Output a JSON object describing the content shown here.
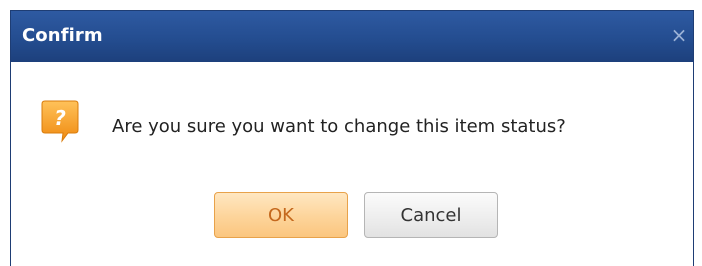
{
  "dialog": {
    "title": "Confirm",
    "close_glyph": "×",
    "icon": "question-icon",
    "message": "Are you sure you want to change this item status?",
    "buttons": {
      "ok_label": "OK",
      "cancel_label": "Cancel"
    }
  },
  "colors": {
    "titlebar": "#244d90",
    "title_text": "#ffffff",
    "icon_orange": "#f39a1f",
    "ok_button": "#fdd49a",
    "ok_text": "#c4681d",
    "cancel_button": "#eeeeee"
  }
}
